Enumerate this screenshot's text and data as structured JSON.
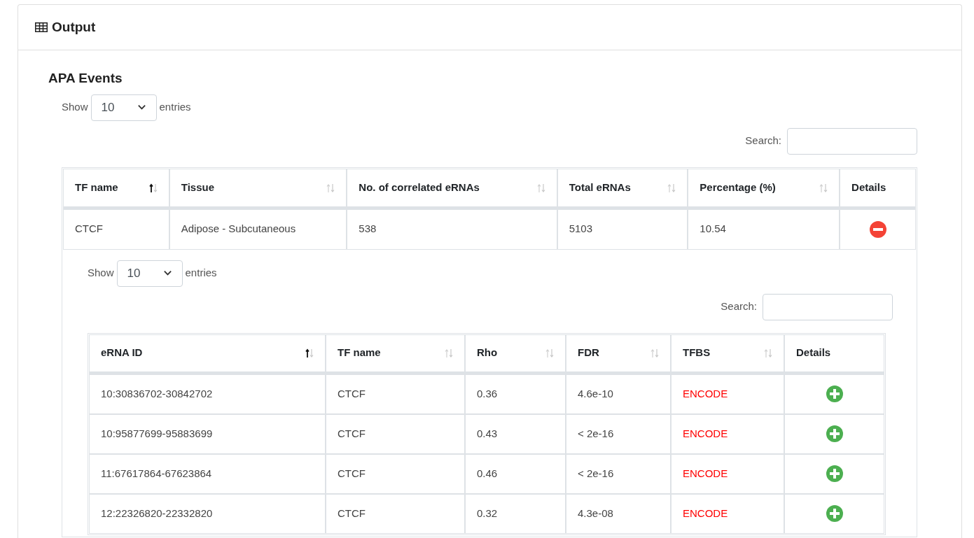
{
  "card": {
    "title": "Output"
  },
  "section_title": "APA Events",
  "length_menu": {
    "show_label": "Show",
    "value": "10",
    "entries_label": "entries"
  },
  "search": {
    "label": "Search:"
  },
  "table": {
    "columns": [
      {
        "label": "TF name",
        "sortable": true,
        "sorted": true
      },
      {
        "label": "Tissue",
        "sortable": true,
        "sorted": false
      },
      {
        "label": "No. of correlated eRNAs",
        "sortable": true,
        "sorted": false
      },
      {
        "label": "Total eRNAs",
        "sortable": true,
        "sorted": false
      },
      {
        "label": "Percentage (%)",
        "sortable": true,
        "sorted": false
      },
      {
        "label": "Details",
        "sortable": false,
        "sorted": false
      }
    ],
    "rows": [
      {
        "cells": [
          "CTCF",
          "Adipose - Subcutaneous",
          "538",
          "5103",
          "10.54"
        ],
        "expanded": true,
        "child": {
          "length_menu": {
            "show_label": "Show",
            "value": "10",
            "entries_label": "entries"
          },
          "search": {
            "label": "Search:"
          },
          "columns": [
            {
              "label": "eRNA ID",
              "sortable": true,
              "sorted": true
            },
            {
              "label": "TF name",
              "sortable": true,
              "sorted": false
            },
            {
              "label": "Rho",
              "sortable": true,
              "sorted": false
            },
            {
              "label": "FDR",
              "sortable": true,
              "sorted": false
            },
            {
              "label": "TFBS",
              "sortable": true,
              "sorted": false
            },
            {
              "label": "Details",
              "sortable": false,
              "sorted": false
            }
          ],
          "rows": [
            {
              "cells": [
                "10:30836702-30842702",
                "CTCF",
                "0.36",
                "4.6e-10",
                "ENCODE"
              ],
              "expanded": false
            },
            {
              "cells": [
                "10:95877699-95883699",
                "CTCF",
                "0.43",
                "< 2e-16",
                "ENCODE"
              ],
              "expanded": false
            },
            {
              "cells": [
                "11:67617864-67623864",
                "CTCF",
                "0.46",
                "< 2e-16",
                "ENCODE"
              ],
              "expanded": false
            },
            {
              "cells": [
                "12:22326820-22332820",
                "CTCF",
                "0.32",
                "4.3e-08",
                "ENCODE"
              ],
              "expanded": false
            }
          ]
        }
      }
    ]
  }
}
